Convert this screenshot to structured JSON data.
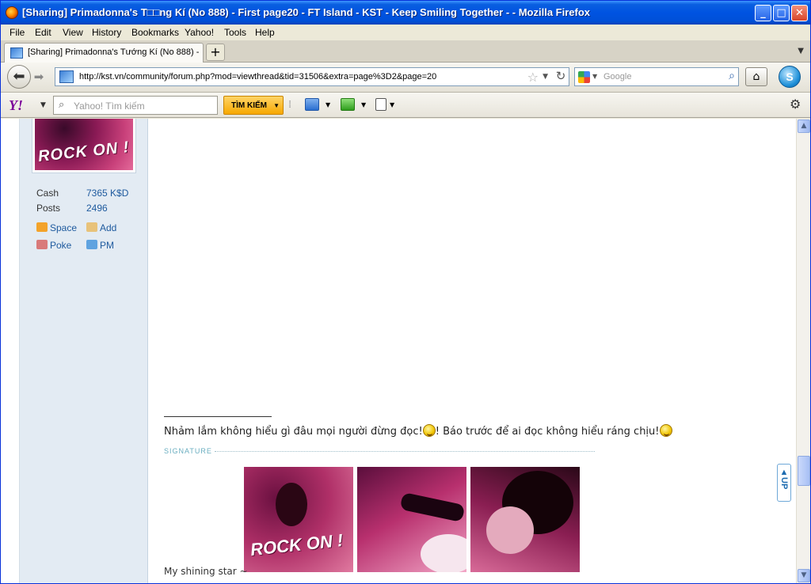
{
  "window": {
    "title": "[Sharing] Primadonna's T□□ng Kí (No 888) - First page20 - FT Island - KST - Keep Smiling Together - - Mozilla Firefox",
    "minimize": "_",
    "maximize": "□",
    "close": "✕"
  },
  "menu": [
    "File",
    "Edit",
    "View",
    "History",
    "Bookmarks",
    "Yahoo!",
    "Tools",
    "Help"
  ],
  "tabs": [
    {
      "label": "[Sharing] Primadonna's Tướng Kí (No 888) - ..."
    }
  ],
  "nav": {
    "url": "http://kst.vn/community/forum.php?mod=viewthread&tid=31506&extra=page%3D2&page=20",
    "search_placeholder": "Google"
  },
  "yahoo_toolbar": {
    "logo": "Y!",
    "search_placeholder": "Yahoo! Tìm kiếm",
    "search_button": "TÌM KIẾM"
  },
  "profile": {
    "avatar_text": "ROCK ON !",
    "stats": [
      {
        "label": "Cash",
        "value": "7365 K$D"
      },
      {
        "label": "Posts",
        "value": "2496"
      }
    ],
    "actions": [
      "Space",
      "Add",
      "Poke",
      "PM"
    ]
  },
  "post": {
    "text_part1": "Nhảm lắm không hiểu gì đâu mọi người đừng đọc!",
    "text_part2": "! Báo trước để ai đọc không hiểu ráng chịu!",
    "signature_label": "SIGNATURE",
    "signature_image_text": "ROCK ON !",
    "caption": "My shining star ~"
  },
  "up_button": "UP",
  "colors": {
    "titlebar": "#0053e1",
    "profile_bg": "#e3ebf3",
    "link": "#1e5a9e",
    "signature": "#6aaec0"
  }
}
